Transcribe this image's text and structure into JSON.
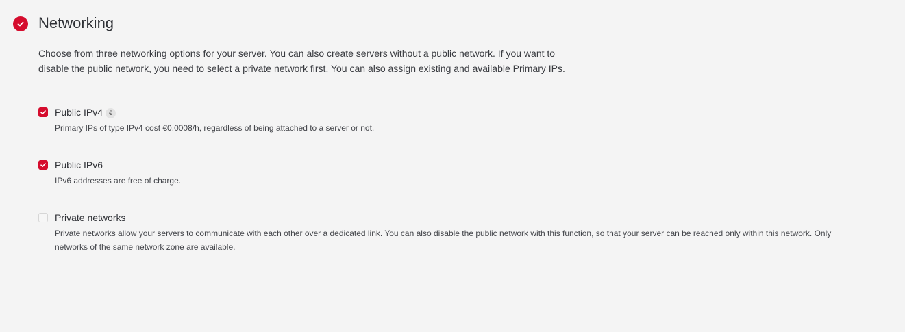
{
  "section": {
    "title": "Networking",
    "intro": "Choose from three networking options for your server. You can also create servers without a public network. If you want to disable the public network, you need to select a private network first. You can also assign existing and available Primary IPs.",
    "status_icon": "check-icon"
  },
  "options": [
    {
      "label": "Public IPv4",
      "badge": "€",
      "description": "Primary IPs of type IPv4 cost €0.0008/h, regardless of being attached to a server or not.",
      "checked": true
    },
    {
      "label": "Public IPv6",
      "description": "IPv6 addresses are free of charge.",
      "checked": true
    },
    {
      "label": "Private networks",
      "description": "Private networks allow your servers to communicate with each other over a dedicated link. You can also disable the public network with this function, so that your server can be reached only within this network. Only networks of the same network zone are available.",
      "checked": false
    }
  ],
  "colors": {
    "accent": "#d50c2d",
    "background": "#f4f4f4",
    "text": "#2f3136"
  }
}
